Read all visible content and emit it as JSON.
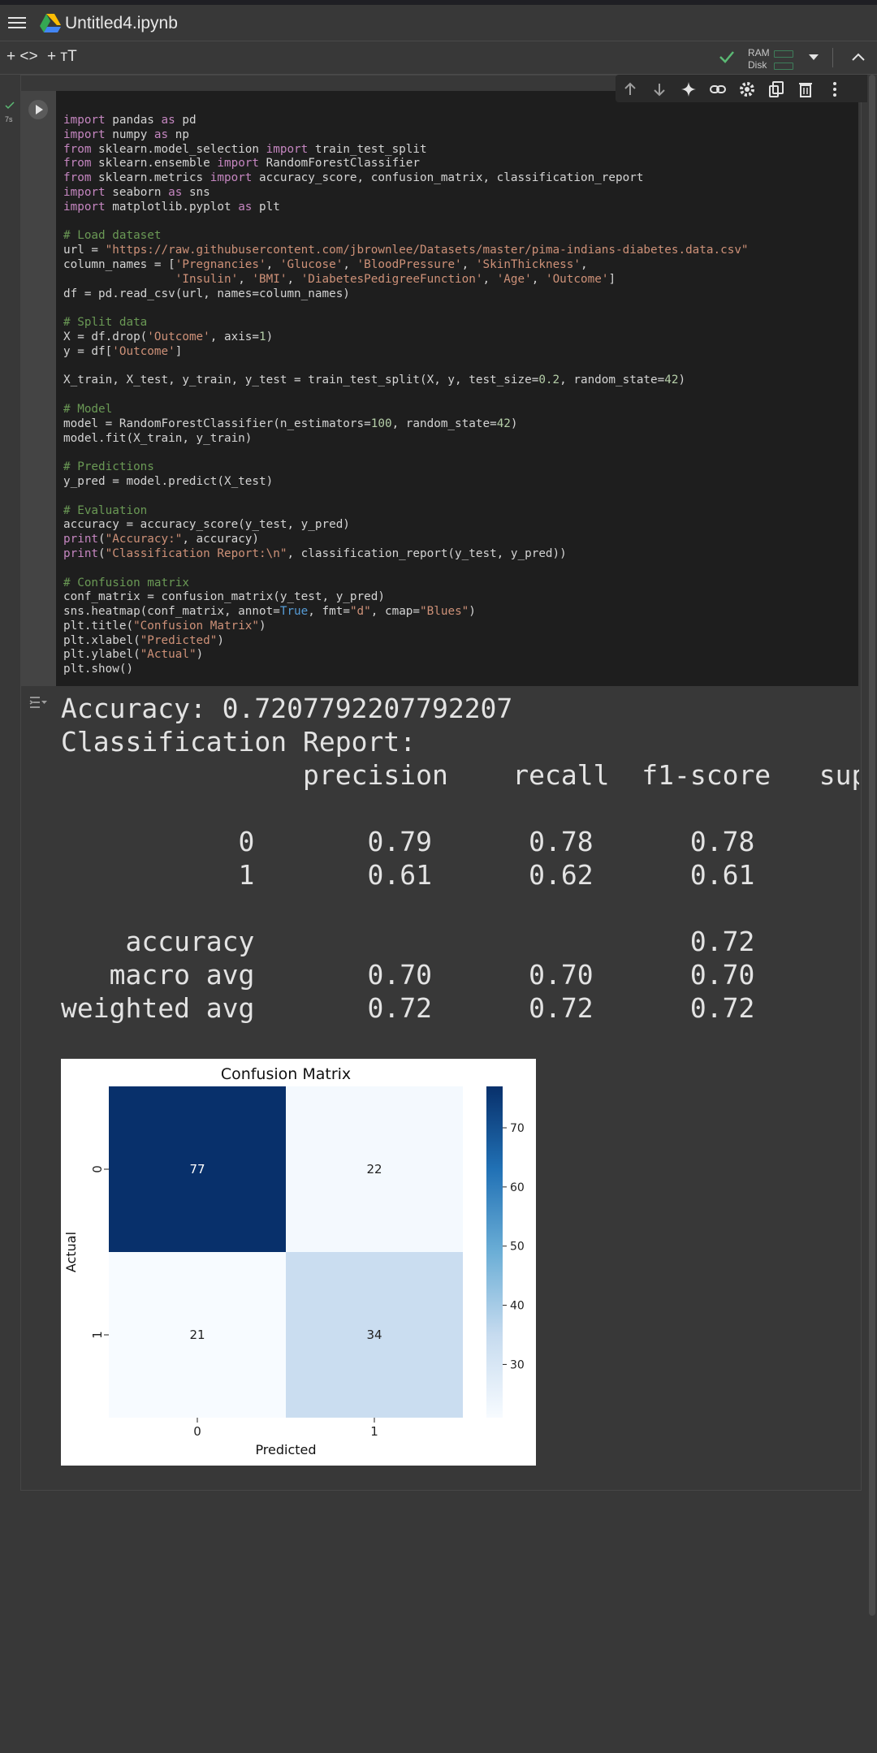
{
  "app": {
    "notebook_title": "Untitled4.ipynb"
  },
  "toolbar": {
    "add_code_label": "+ <>",
    "add_text_label": "+ тT",
    "ram_label": "RAM",
    "disk_label": "Disk"
  },
  "cell": {
    "exec_time": "7s",
    "code_lines": [
      "import pandas as pd",
      "import numpy as np",
      "from sklearn.model_selection import train_test_split",
      "from sklearn.ensemble import RandomForestClassifier",
      "from sklearn.metrics import accuracy_score, confusion_matrix, classification_report",
      "import seaborn as sns",
      "import matplotlib.pyplot as plt",
      "",
      "# Load dataset",
      "url = \"https://raw.githubusercontent.com/jbrownlee/Datasets/master/pima-indians-diabetes.data.csv\"",
      "column_names = ['Pregnancies', 'Glucose', 'BloodPressure', 'SkinThickness',",
      "                'Insulin', 'BMI', 'DiabetesPedigreeFunction', 'Age', 'Outcome']",
      "df = pd.read_csv(url, names=column_names)",
      "",
      "# Split data",
      "X = df.drop('Outcome', axis=1)",
      "y = df['Outcome']",
      "",
      "X_train, X_test, y_train, y_test = train_test_split(X, y, test_size=0.2, random_state=42)",
      "",
      "# Model",
      "model = RandomForestClassifier(n_estimators=100, random_state=42)",
      "model.fit(X_train, y_train)",
      "",
      "# Predictions",
      "y_pred = model.predict(X_test)",
      "",
      "# Evaluation",
      "accuracy = accuracy_score(y_test, y_pred)",
      "print(\"Accuracy:\", accuracy)",
      "print(\"Classification Report:\\n\", classification_report(y_test, y_pred))",
      "",
      "# Confusion matrix",
      "conf_matrix = confusion_matrix(y_test, y_pred)",
      "sns.heatmap(conf_matrix, annot=True, fmt=\"d\", cmap=\"Blues\")",
      "plt.title(\"Confusion Matrix\")",
      "plt.xlabel(\"Predicted\")",
      "plt.ylabel(\"Actual\")",
      "plt.show()"
    ]
  },
  "output": {
    "lines": [
      "Accuracy: 0.7207792207792207",
      "Classification Report:",
      "               precision    recall  f1-score   sup",
      "",
      "           0       0.79      0.78      0.78",
      "           1       0.61      0.62      0.61",
      "",
      "    accuracy                           0.72",
      "   macro avg       0.70      0.70      0.70",
      "weighted avg       0.72      0.72      0.72"
    ]
  },
  "chart_data": {
    "type": "heatmap",
    "title": "Confusion Matrix",
    "xlabel": "Predicted",
    "ylabel": "Actual",
    "x_categories": [
      "0",
      "1"
    ],
    "y_categories": [
      "0",
      "1"
    ],
    "values": [
      [
        77,
        22
      ],
      [
        21,
        34
      ]
    ],
    "colormap": "Blues",
    "colorbar_ticks": [
      30,
      40,
      50,
      60,
      70
    ],
    "colorbar_range": [
      21,
      77
    ]
  },
  "colors": {
    "accent_green": "#5bb974",
    "background": "#383838",
    "code_background": "#1e1e1e"
  }
}
